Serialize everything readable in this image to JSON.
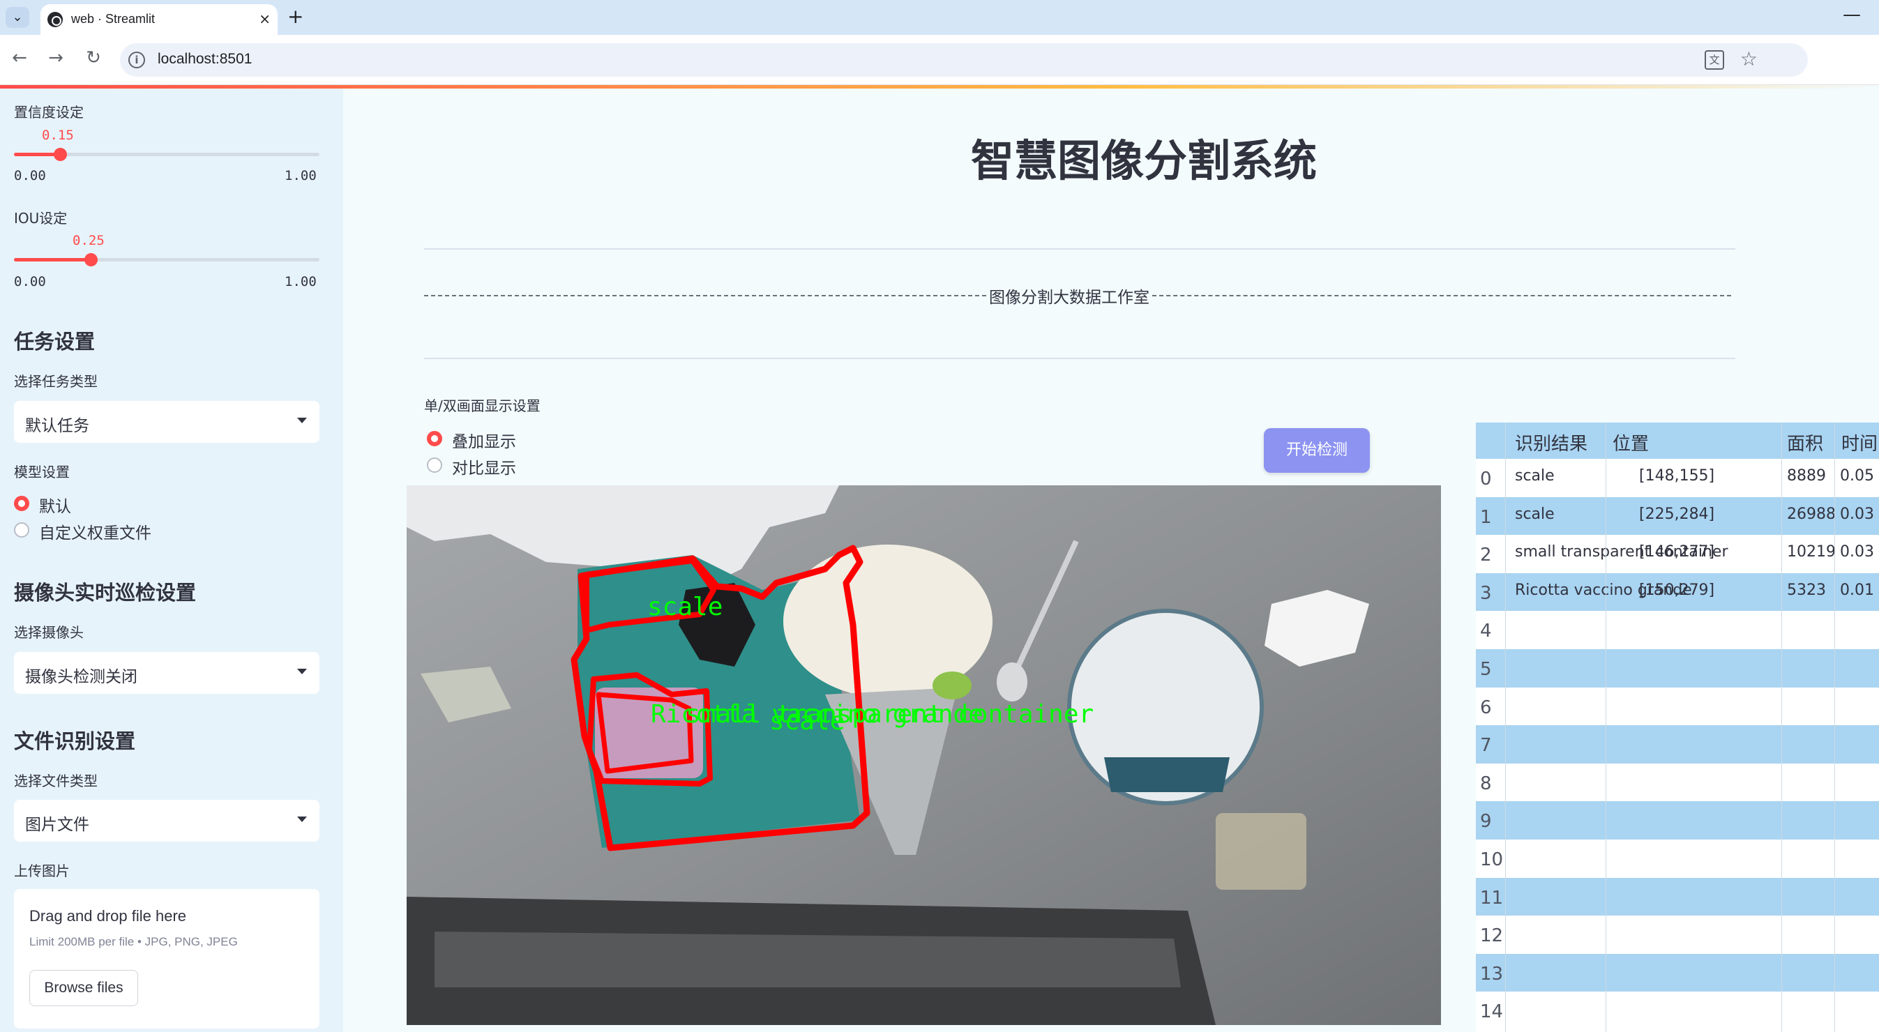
{
  "browser": {
    "tab_title": "web · Streamlit",
    "tab_close": "×",
    "new_tab": "+",
    "url": "localhost:8501",
    "minimize": "—",
    "tab_list": "⌄"
  },
  "sidebar": {
    "confidence": {
      "label": "置信度设定",
      "value": "0.15",
      "value_num": 0.15,
      "min": "0.00",
      "max": "1.00"
    },
    "iou": {
      "label": "IOU设定",
      "value": "0.25",
      "value_num": 0.25,
      "min": "0.00",
      "max": "1.00"
    },
    "task_header": "任务设置",
    "task_type_label": "选择任务类型",
    "task_type_value": "默认任务",
    "model_label": "模型设置",
    "model_options": [
      "默认",
      "自定义权重文件"
    ],
    "camera_header": "摄像头实时巡检设置",
    "camera_label": "选择摄像头",
    "camera_value": "摄像头检测关闭",
    "file_header": "文件识别设置",
    "file_type_label": "选择文件类型",
    "file_type_value": "图片文件",
    "upload_label": "上传图片",
    "upload_title": "Drag and drop file here",
    "upload_hint": "Limit 200MB per file • JPG, PNG, JPEG",
    "upload_button": "Browse files"
  },
  "main": {
    "title": "智慧图像分割系统",
    "studio_text": "图像分割大数据工作室",
    "display_label": "单/双画面显示设置",
    "display_options": [
      "叠加显示",
      "对比显示"
    ],
    "detect_button": "开始检测",
    "overlay_labels": [
      "scale",
      "Ricotta vaccino grande",
      "scale",
      "small transparent container"
    ]
  },
  "results_table": {
    "headers": [
      "识别结果",
      "位置",
      "面积",
      "时间"
    ],
    "rows": [
      {
        "index": "0",
        "result": "scale",
        "position": "[148,155]",
        "area": "8889",
        "time": "0.05"
      },
      {
        "index": "1",
        "result": "scale",
        "position": "[225,284]",
        "area": "26988",
        "time": "0.03"
      },
      {
        "index": "2",
        "result": "small transparent container",
        "position": "[146,277]",
        "area": "10219",
        "time": "0.03"
      },
      {
        "index": "3",
        "result": "Ricotta vaccino grande",
        "position": "[150,279]",
        "area": "5323",
        "time": "0.01"
      },
      {
        "index": "4",
        "result": "",
        "position": "",
        "area": "",
        "time": ""
      },
      {
        "index": "5",
        "result": "",
        "position": "",
        "area": "",
        "time": ""
      },
      {
        "index": "6",
        "result": "",
        "position": "",
        "area": "",
        "time": ""
      },
      {
        "index": "7",
        "result": "",
        "position": "",
        "area": "",
        "time": ""
      },
      {
        "index": "8",
        "result": "",
        "position": "",
        "area": "",
        "time": ""
      },
      {
        "index": "9",
        "result": "",
        "position": "",
        "area": "",
        "time": ""
      },
      {
        "index": "10",
        "result": "",
        "position": "",
        "area": "",
        "time": ""
      },
      {
        "index": "11",
        "result": "",
        "position": "",
        "area": "",
        "time": ""
      },
      {
        "index": "12",
        "result": "",
        "position": "",
        "area": "",
        "time": ""
      },
      {
        "index": "13",
        "result": "",
        "position": "",
        "area": "",
        "time": ""
      },
      {
        "index": "14",
        "result": "",
        "position": "",
        "area": "",
        "time": ""
      }
    ]
  },
  "colors": {
    "accent": "#ff4b4b",
    "button": "#8c93f1",
    "table_stripe": "#a9d4f2",
    "mask_outline": "#ff0000",
    "mask_label": "#00ff00"
  }
}
